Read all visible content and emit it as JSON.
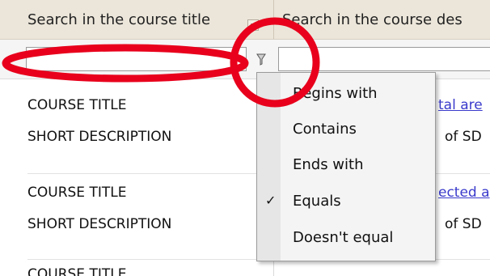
{
  "header": {
    "col1_label": "Search in the course title",
    "col2_label": "Search in the course des"
  },
  "filter": {
    "title_value": "",
    "description_value": "",
    "filter_icon": "filter-funnel-icon"
  },
  "rows": [
    {
      "title_label": "COURSE TITLE",
      "title_link": "tal are",
      "desc_label": "SHORT DESCRIPTION",
      "desc_value": "of SD"
    },
    {
      "title_label": "COURSE TITLE",
      "title_link": "ected a",
      "desc_label": "SHORT DESCRIPTION",
      "desc_value": "of SD"
    },
    {
      "title_label": "COURSE TITLE"
    }
  ],
  "filter_menu": {
    "items": [
      {
        "label": "Begins with",
        "checked": false
      },
      {
        "label": "Contains",
        "checked": false
      },
      {
        "label": "Ends with",
        "checked": false
      },
      {
        "label": "Equals",
        "checked": true
      },
      {
        "label": "Doesn't equal",
        "checked": false
      }
    ],
    "check_glyph": "✓"
  },
  "annotations": {
    "color": "#e8001c"
  }
}
